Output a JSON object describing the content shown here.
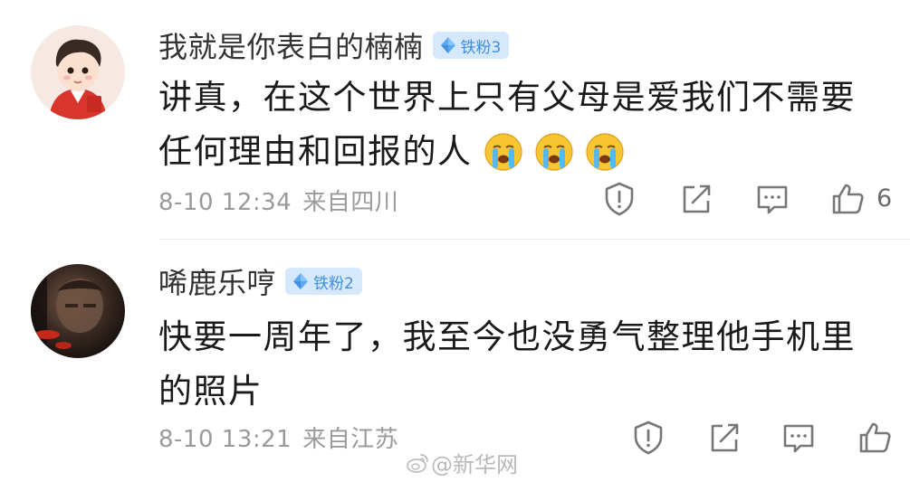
{
  "comments": [
    {
      "username": "我就是你表白的楠楠",
      "fan_badge": "铁粉3",
      "text": "讲真，在这个世界上只有父母是爱我们不需要任何理由和回报的人",
      "emojis": [
        "crying-face-emoji",
        "crying-face-emoji",
        "crying-face-emoji"
      ],
      "time": "8-10 12:34",
      "location": "来自四川",
      "like_count": "6",
      "avatar": "cartoon-boy-avatar"
    },
    {
      "username": "唏鹿乐哼",
      "fan_badge": "铁粉2",
      "text": "快要一周年了，我至今也没勇气整理他手机里的照片",
      "time": "8-10 13:21",
      "location": "来自江苏",
      "avatar": "dark-photo-avatar"
    }
  ],
  "actions": [
    "report-icon",
    "share-icon",
    "comment-icon",
    "like-icon"
  ],
  "watermark": "@新华网",
  "colors": {
    "badge_bg": "#d6e8fb",
    "badge_text": "#3f8ee0",
    "username": "#333333",
    "meta": "#9a9a9a"
  }
}
